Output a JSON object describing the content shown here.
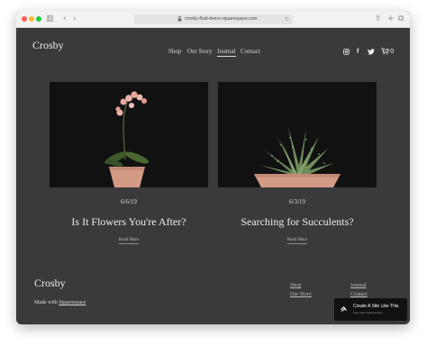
{
  "browser": {
    "url": "crosby-fluid-demo.squarespace.com",
    "icons": [
      "sidebar-icon",
      "back-icon",
      "forward-icon",
      "lock-icon",
      "reload-icon",
      "share-icon",
      "new-tab-icon",
      "tabs-icon"
    ]
  },
  "header": {
    "logo": "Crosby",
    "nav": [
      "Shop",
      "Our Story",
      "Journal",
      "Contact"
    ],
    "active_nav": "Journal",
    "social_icons": [
      "instagram-icon",
      "facebook-icon",
      "twitter-icon",
      "cart-icon"
    ],
    "cart_count": "0"
  },
  "posts": [
    {
      "date": "6/6/19",
      "title": "Is It Flowers You're After?",
      "read_more": "Read More",
      "image": "orchid-in-terracotta-pot"
    },
    {
      "date": "6/3/19",
      "title": "Searching for Succulents?",
      "read_more": "Read More",
      "image": "succulent-in-terracotta-pot"
    }
  ],
  "footer": {
    "logo": "Crosby",
    "made_with": "Made with",
    "made_with_link": "Squarespace",
    "links": [
      "Shop",
      "Our Story",
      "Journal",
      "Contact"
    ]
  },
  "badge": {
    "title": "Create A Site Like This",
    "subtitle": "Free trial. Instant access."
  },
  "colors": {
    "page_background": "#3a3a3c",
    "text": "#efede8",
    "photo_background": "#111112",
    "pot": "#d39a86",
    "badge_background": "#111111"
  }
}
